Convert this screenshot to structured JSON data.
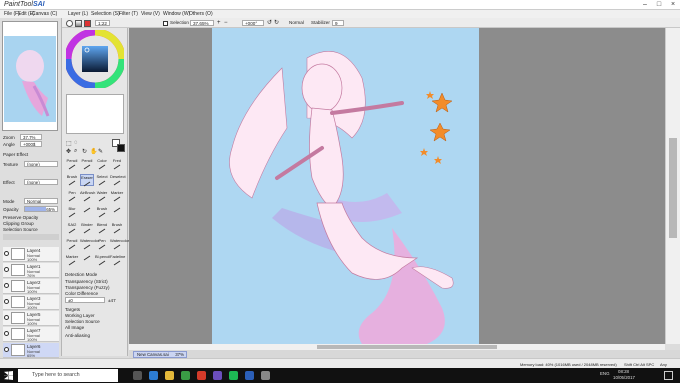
{
  "app": {
    "title_prefix": "PaintTool",
    "title_brand": "SAI"
  },
  "menu": [
    "Layer (L)",
    "Selection (S)",
    "Filter (T)",
    "View (V)",
    "Window (W)",
    "Others (O)"
  ],
  "file_menu": [
    "File (F)",
    "Edit (E)",
    "Canvas (C)"
  ],
  "toolbar": {
    "size_value": "1:22",
    "selection_label": "Selection",
    "zoom_value": "37.65%",
    "rotate_value": "+000°",
    "normal_label": "Normal",
    "stabilizer_label": "Stabilizer",
    "stabilizer_value": "9"
  },
  "navigator": {
    "zoom_label": "Zoom",
    "zoom_value": "37.7%",
    "angle_label": "Angle",
    "angle_value": "+000$"
  },
  "layer_panel": {
    "paper_effect": "Paper Effect",
    "texture_label": "Texture",
    "texture_value": "(none)",
    "effect_label": "Effect",
    "effect_value": "(none)",
    "mode_label": "Mode",
    "mode_value": "Normal",
    "opacity_label": "Opacity",
    "opacity_value": "65%",
    "preserve_opacity": "Preserve Opacity",
    "clipping_group": "Clipping Group",
    "selection_source": "Selection Source",
    "layers": [
      {
        "name": "Layer4",
        "mode": "Normal",
        "opacity": "100%"
      },
      {
        "name": "Layer1",
        "mode": "Normal",
        "opacity": "76%"
      },
      {
        "name": "Layer2",
        "mode": "Normal",
        "opacity": "100%"
      },
      {
        "name": "Layer3",
        "mode": "Normal",
        "opacity": "100%"
      },
      {
        "name": "Layer5",
        "mode": "Normal",
        "opacity": "100%"
      },
      {
        "name": "Layer7",
        "mode": "Normal",
        "opacity": "100%"
      },
      {
        "name": "Layer6",
        "mode": "Normal",
        "opacity": "65%"
      },
      {
        "name": "Layer8",
        "mode": "Normal",
        "opacity": "100%"
      }
    ]
  },
  "tools": [
    "Pencil",
    "Pencil",
    "Color",
    "Fred",
    "Brush",
    "Eraser",
    "Select",
    "Deselect",
    "Pen",
    "AirBrush",
    "Water",
    "Marker",
    "Blur",
    "",
    "Brush",
    "",
    "SAI2",
    "Binder",
    "Blend",
    "Brush",
    "Pencil",
    "Watercolor",
    "Pen",
    "Watercolor",
    "Marker",
    "",
    "Bl.pencil",
    "Fadeline"
  ],
  "tool_options": {
    "detection_mode_label": "Detection Mode",
    "modes": [
      "Transparency (Strict)",
      "Transparency (Fuzzy)",
      "Color Difference"
    ],
    "range_value": "±0",
    "range_label": "±47",
    "targets_label": "Targets",
    "targets": [
      "Working Layer",
      "Selection Source",
      "All Image"
    ],
    "anti_aliasing": "Anti-aliasing"
  },
  "document": {
    "tab_name": "New Canvas.sai",
    "tab_zoom": "37%"
  },
  "status": {
    "memory": "Memory load: 40% (1016MB used / 2048MB reserved)",
    "keys": "Shift Ctrl Alt SPC",
    "any": "Any"
  },
  "taskbar": {
    "search_placeholder": "Type here to search",
    "language": "ENG",
    "time": "08:28",
    "date": "10/05/2017"
  },
  "colors": {
    "accent": "#2b5fb8",
    "canvas_bg": "#aed7f2",
    "selection": "#cfd8f5"
  }
}
